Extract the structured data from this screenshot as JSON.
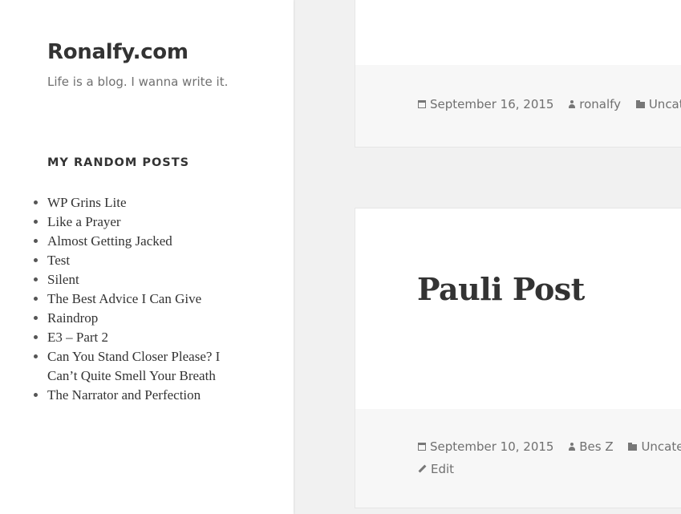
{
  "site": {
    "title": "Ronalfy.com",
    "description": "Life is a blog. I wanna write it."
  },
  "widget": {
    "title": "MY RANDOM POSTS",
    "posts": [
      "WP Grins Lite",
      "Like a Prayer",
      "Almost Getting Jacked",
      "Test",
      "Silent",
      "The Best Advice I Can Give",
      "Raindrop",
      "E3 – Part 2",
      "Can You Stand Closer Please? I Can’t Quite Smell Your Breath",
      "The Narrator and Perfection"
    ]
  },
  "posts": [
    {
      "title": "",
      "date": "September 16, 2015",
      "author": "ronalfy",
      "category": "Uncat"
    },
    {
      "title": "Pauli Post",
      "date": "September 10, 2015",
      "author": "Bes Z",
      "category": "Uncateg",
      "edit_label": "Edit"
    }
  ],
  "colors": {
    "background": "#f1f1f1",
    "sidebar": "#ffffff",
    "card": "#ffffff",
    "card_footer": "#f7f7f7",
    "text": "#333333",
    "meta_text": "#707070"
  },
  "icons": {
    "date": "calendar-icon",
    "author": "person-icon",
    "category": "folder-icon",
    "edit": "pencil-icon"
  }
}
